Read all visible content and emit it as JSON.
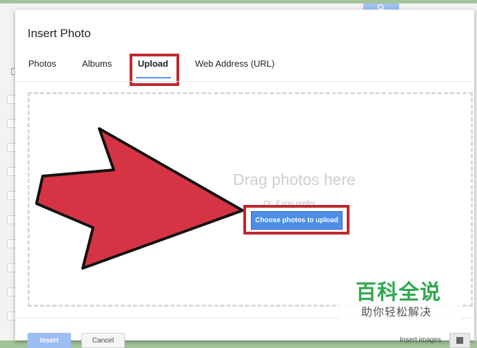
{
  "dialog": {
    "title": "Insert Photo",
    "tabs": [
      {
        "label": "Photos"
      },
      {
        "label": "Albums"
      },
      {
        "label": "Upload",
        "active": true
      },
      {
        "label": "Web Address (URL)"
      }
    ]
  },
  "upload": {
    "drag_text": "Drag photos here",
    "or_text": "Or, if you prefer",
    "choose_button": "Choose photos to upload"
  },
  "footer": {
    "insert_button": "Insert",
    "cancel_button": "Cancel",
    "insert_images_label": "Insert images"
  },
  "watermark": {
    "title": "百科全说",
    "subtitle": "助你轻松解决"
  },
  "icons": {
    "search": "search-icon",
    "annotation_arrow": "arrow-pointer-icon"
  },
  "colors": {
    "highlight": "#c0272d",
    "arrow_fill": "#d63444",
    "primary_blue": "#4d8fe6",
    "tab_underline": "#4d90fe",
    "watermark_green": "#2fa84f"
  }
}
